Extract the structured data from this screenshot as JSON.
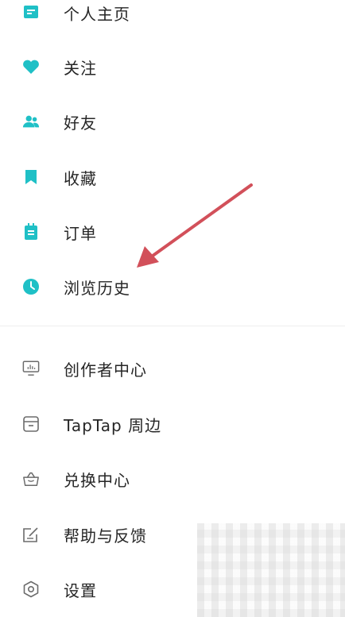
{
  "colors": {
    "accent": "#1fc0c6",
    "outline_icon": "#6b6b6b",
    "text": "#262626",
    "arrow": "#d2505a",
    "divider": "#eeeeee"
  },
  "menu": {
    "primary": [
      {
        "label": "个人主页",
        "icon": "profile-icon"
      },
      {
        "label": "关注",
        "icon": "heart-icon"
      },
      {
        "label": "好友",
        "icon": "friends-icon"
      },
      {
        "label": "收藏",
        "icon": "bookmark-icon"
      },
      {
        "label": "订单",
        "icon": "order-icon"
      },
      {
        "label": "浏览历史",
        "icon": "clock-icon"
      }
    ],
    "secondary": [
      {
        "label": "创作者中心",
        "icon": "monitor-icon"
      },
      {
        "label": "TapTap 周边",
        "icon": "store-icon"
      },
      {
        "label": "兑换中心",
        "icon": "bag-icon"
      },
      {
        "label": "帮助与反馈",
        "icon": "feedback-icon"
      },
      {
        "label": "设置",
        "icon": "settings-icon"
      }
    ]
  }
}
